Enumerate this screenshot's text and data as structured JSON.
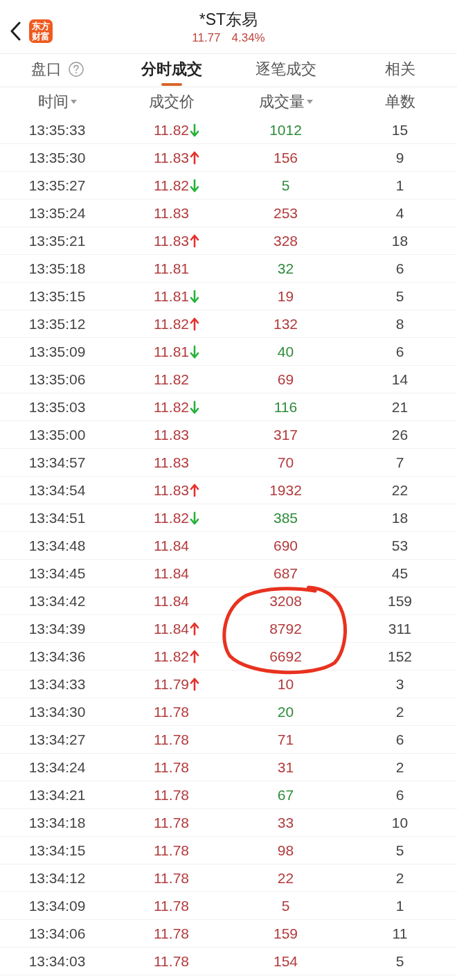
{
  "header": {
    "logo": "东方财富",
    "title": "*ST东易",
    "price": "11.77",
    "change": "4.34%"
  },
  "tabs": [
    {
      "label": "盘口",
      "selected": false,
      "help_icon": true
    },
    {
      "label": "分时成交",
      "selected": true,
      "help_icon": false
    },
    {
      "label": "逐笔成交",
      "selected": false,
      "help_icon": false
    },
    {
      "label": "相关",
      "selected": false,
      "help_icon": false
    }
  ],
  "table": {
    "columns": [
      {
        "label": "时间",
        "sort_caret": true
      },
      {
        "label": "成交价",
        "sort_caret": false
      },
      {
        "label": "成交量",
        "sort_caret": true
      },
      {
        "label": "单数",
        "sort_caret": false
      }
    ],
    "rows": [
      {
        "time": "13:35:33",
        "price": "11.82",
        "kind": "down",
        "volume": "1012",
        "color": "#2e8b3a",
        "count": "15",
        "circled": false
      },
      {
        "time": "13:35:30",
        "price": "11.83",
        "kind": "up",
        "volume": "156",
        "color": "#b23a3c",
        "count": "9",
        "circled": false
      },
      {
        "time": "13:35:27",
        "price": "11.82",
        "kind": "down",
        "volume": "5",
        "color": "#2e8b3a",
        "count": "1",
        "circled": false
      },
      {
        "time": "13:35:24",
        "price": "11.83",
        "kind": "plain",
        "volume": "253",
        "color": "#b23a3c",
        "count": "4",
        "circled": false
      },
      {
        "time": "13:35:21",
        "price": "11.83",
        "kind": "up",
        "volume": "328",
        "color": "#b23a3c",
        "count": "18",
        "circled": false
      },
      {
        "time": "13:35:18",
        "price": "11.81",
        "kind": "plain",
        "volume": "32",
        "color": "#2e8b3a",
        "count": "6",
        "circled": false
      },
      {
        "time": "13:35:15",
        "price": "11.81",
        "kind": "down",
        "volume": "19",
        "color": "#b23a3c",
        "count": "5",
        "circled": false
      },
      {
        "time": "13:35:12",
        "price": "11.82",
        "kind": "up",
        "volume": "132",
        "color": "#b23a3c",
        "count": "8",
        "circled": false
      },
      {
        "time": "13:35:09",
        "price": "11.81",
        "kind": "down",
        "volume": "40",
        "color": "#2e8b3a",
        "count": "6",
        "circled": false
      },
      {
        "time": "13:35:06",
        "price": "11.82",
        "kind": "plain",
        "volume": "69",
        "color": "#b23a3c",
        "count": "14",
        "circled": false
      },
      {
        "time": "13:35:03",
        "price": "11.82",
        "kind": "down",
        "volume": "116",
        "color": "#2e8b3a",
        "count": "21",
        "circled": false
      },
      {
        "time": "13:35:00",
        "price": "11.83",
        "kind": "plain",
        "volume": "317",
        "color": "#b23a3c",
        "count": "26",
        "circled": false
      },
      {
        "time": "13:34:57",
        "price": "11.83",
        "kind": "plain",
        "volume": "70",
        "color": "#b23a3c",
        "count": "7",
        "circled": false
      },
      {
        "time": "13:34:54",
        "price": "11.83",
        "kind": "up",
        "volume": "1932",
        "color": "#b23a3c",
        "count": "22",
        "circled": false
      },
      {
        "time": "13:34:51",
        "price": "11.82",
        "kind": "down",
        "volume": "385",
        "color": "#2e8b3a",
        "count": "18",
        "circled": false
      },
      {
        "time": "13:34:48",
        "price": "11.84",
        "kind": "plain",
        "volume": "690",
        "color": "#b23a3c",
        "count": "53",
        "circled": false
      },
      {
        "time": "13:34:45",
        "price": "11.84",
        "kind": "plain",
        "volume": "687",
        "color": "#b23a3c",
        "count": "45",
        "circled": false
      },
      {
        "time": "13:34:42",
        "price": "11.84",
        "kind": "plain",
        "volume": "3208",
        "color": "#b23a3c",
        "count": "159",
        "circled": true
      },
      {
        "time": "13:34:39",
        "price": "11.84",
        "kind": "up",
        "volume": "8792",
        "color": "#b23a3c",
        "count": "311",
        "circled": true
      },
      {
        "time": "13:34:36",
        "price": "11.82",
        "kind": "up",
        "volume": "6692",
        "color": "#b23a3c",
        "count": "152",
        "circled": true
      },
      {
        "time": "13:34:33",
        "price": "11.79",
        "kind": "up",
        "volume": "10",
        "color": "#b23a3c",
        "count": "3",
        "circled": false
      },
      {
        "time": "13:34:30",
        "price": "11.78",
        "kind": "plain",
        "volume": "20",
        "color": "#2e8b3a",
        "count": "2",
        "circled": false
      },
      {
        "time": "13:34:27",
        "price": "11.78",
        "kind": "plain",
        "volume": "71",
        "color": "#b23a3c",
        "count": "6",
        "circled": false
      },
      {
        "time": "13:34:24",
        "price": "11.78",
        "kind": "plain",
        "volume": "31",
        "color": "#b23a3c",
        "count": "2",
        "circled": false
      },
      {
        "time": "13:34:21",
        "price": "11.78",
        "kind": "plain",
        "volume": "67",
        "color": "#2e8b3a",
        "count": "6",
        "circled": false
      },
      {
        "time": "13:34:18",
        "price": "11.78",
        "kind": "plain",
        "volume": "33",
        "color": "#b23a3c",
        "count": "10",
        "circled": false
      },
      {
        "time": "13:34:15",
        "price": "11.78",
        "kind": "plain",
        "volume": "98",
        "color": "#b23a3c",
        "count": "5",
        "circled": false
      },
      {
        "time": "13:34:12",
        "price": "11.78",
        "kind": "plain",
        "volume": "22",
        "color": "#b23a3c",
        "count": "2",
        "circled": false
      },
      {
        "time": "13:34:09",
        "price": "11.78",
        "kind": "plain",
        "volume": "5",
        "color": "#b23a3c",
        "count": "1",
        "circled": false
      },
      {
        "time": "13:34:06",
        "price": "11.78",
        "kind": "plain",
        "volume": "159",
        "color": "#b23a3c",
        "count": "11",
        "circled": false
      },
      {
        "time": "13:34:03",
        "price": "11.78",
        "kind": "plain",
        "volume": "154",
        "color": "#b23a3c",
        "count": "5",
        "circled": false
      }
    ]
  }
}
